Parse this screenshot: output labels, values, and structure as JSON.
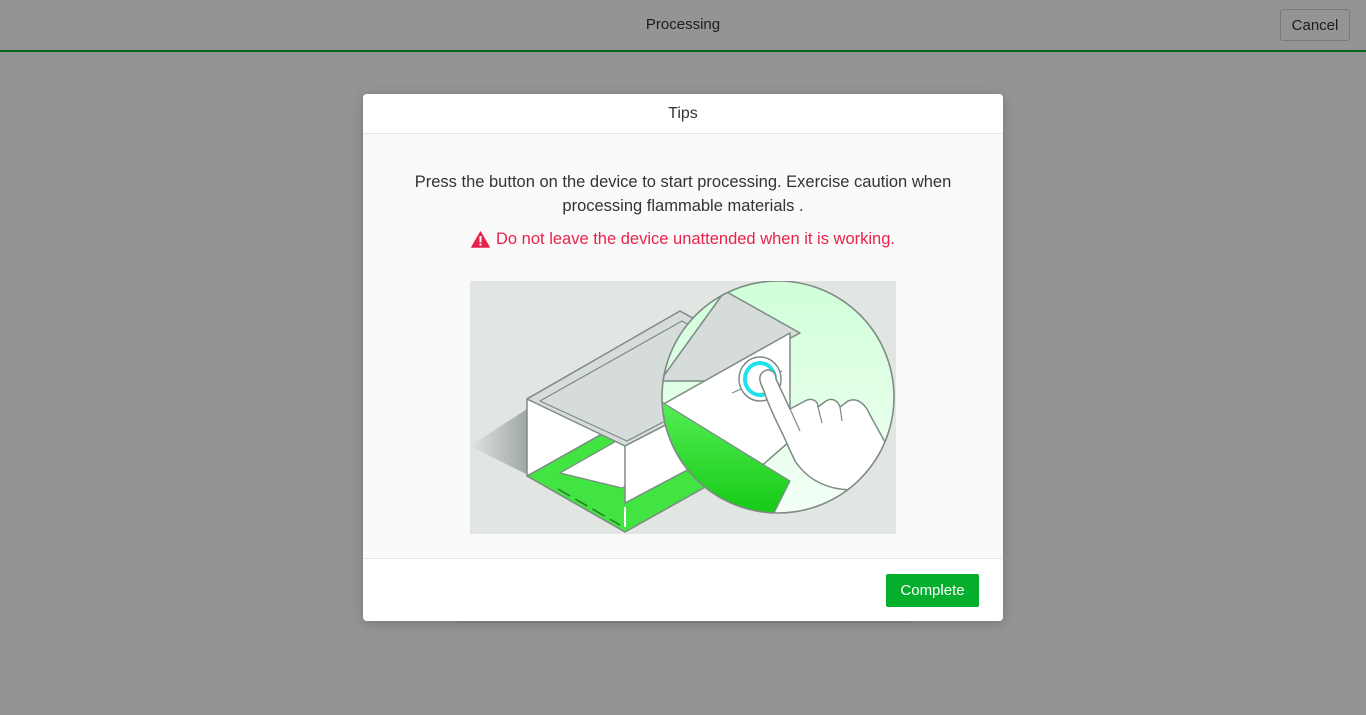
{
  "header": {
    "title": "Processing",
    "cancel_label": "Cancel"
  },
  "dialog": {
    "title": "Tips",
    "message": "Press the button on the device to start processing. Exercise caution when processing flammable materials .",
    "warning": "Do not leave the device unattended when it is working.",
    "complete_label": "Complete"
  },
  "icons": {
    "warning": "warning-triangle-icon",
    "illustration": "press-device-button-illustration"
  },
  "colors": {
    "accent": "#05ae2c",
    "warning": "#e8234b",
    "overlay": "rgba(0,0,0,0.42)",
    "button_glow": "#1ee3ea"
  }
}
